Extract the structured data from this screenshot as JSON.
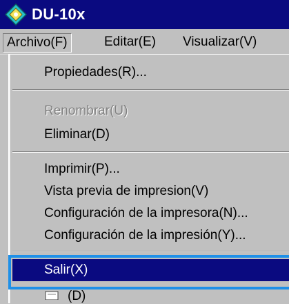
{
  "window": {
    "title": "DU-10x",
    "icon": "app-diamond-icon"
  },
  "menubar": {
    "items": [
      {
        "label": "Archivo(F)"
      },
      {
        "label": "Editar(E)"
      },
      {
        "label": "Visualizar(V)"
      }
    ]
  },
  "dropdown": {
    "items": [
      {
        "label": "Propiedades(R)...",
        "enabled": true
      },
      {
        "label": "Renombrar(U)",
        "enabled": false
      },
      {
        "label": "Eliminar(D)",
        "enabled": true
      },
      {
        "label": "Imprimir(P)...",
        "enabled": true
      },
      {
        "label": "Vista previa de impresion(V)",
        "enabled": true
      },
      {
        "label": "Configuración de la impresora(N)...",
        "enabled": true
      },
      {
        "label": "Configuración de la impresión(Y)...",
        "enabled": true
      },
      {
        "label": "Salir(X)",
        "enabled": true,
        "selected": true
      }
    ],
    "partial_item_label": "(D)"
  },
  "colors": {
    "titlebar": "#0a0a80",
    "menu_bg": "#c0c0c0",
    "selection": "#0a0a80",
    "highlight_frame": "#1e90e8"
  }
}
